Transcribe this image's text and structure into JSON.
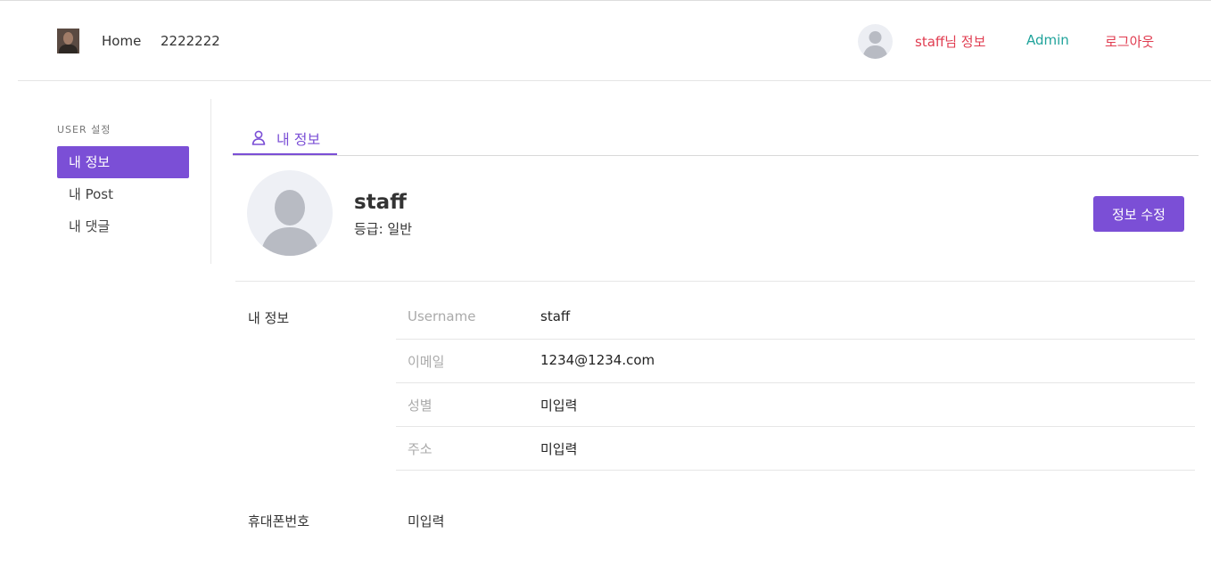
{
  "header": {
    "nav": {
      "home": "Home",
      "second": "2222222"
    },
    "user_info": "staff님 정보",
    "admin": "Admin",
    "logout": "로그아웃"
  },
  "sidebar": {
    "title": "USER 설정",
    "items": [
      {
        "label": "내 정보",
        "active": true
      },
      {
        "label": "내 Post",
        "active": false
      },
      {
        "label": "내 댓글",
        "active": false
      }
    ]
  },
  "tab": {
    "label": "내 정보",
    "icon": "user-icon"
  },
  "profile": {
    "name": "staff",
    "grade": "등급: 일반",
    "edit_button": "정보 수정"
  },
  "details": {
    "section_label": "내 정보",
    "rows": [
      {
        "key": "Username",
        "value": "staff"
      },
      {
        "key": "이메일",
        "value": "1234@1234.com"
      },
      {
        "key": "성별",
        "value": "미입력"
      },
      {
        "key": "주소",
        "value": "미입력"
      }
    ]
  },
  "phone": {
    "label": "휴대폰번호",
    "value": "미입력"
  },
  "colors": {
    "accent": "#7b4fd6",
    "user_link": "#e03c50",
    "admin_link": "#20a39b",
    "logout_link": "#e03c50"
  }
}
